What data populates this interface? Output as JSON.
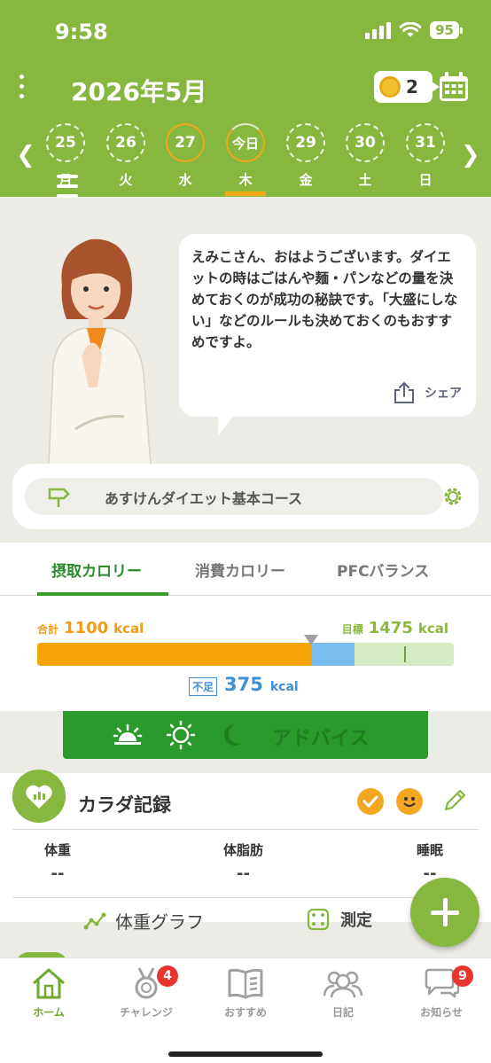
{
  "status": {
    "time": "9:58",
    "battery": "95"
  },
  "header": {
    "title": "2026年5月",
    "badge_count": "2"
  },
  "week": {
    "days": [
      {
        "num": "25",
        "wd": "月"
      },
      {
        "num": "26",
        "wd": "火"
      },
      {
        "num": "27",
        "wd": "水"
      },
      {
        "num": "今日",
        "wd": "木"
      },
      {
        "num": "29",
        "wd": "金"
      },
      {
        "num": "30",
        "wd": "土"
      },
      {
        "num": "31",
        "wd": "日"
      }
    ],
    "prev_icon": "chevron-left-icon",
    "next_icon": "chevron-right-icon"
  },
  "advisor": {
    "message": "えみこさん、おはようございます。ダイエットの時はごはんや麺・パンなどの量を決めておくのが成功の秘訣です。「大盛にしない」などのルールも決めておくのもおすすめですよ。",
    "share_label": "シェア"
  },
  "course": {
    "name": "あすけんダイエット基本コース"
  },
  "calories": {
    "tabs": [
      "摂取カロリー",
      "消費カロリー",
      "PFCバランス"
    ],
    "total_label": "合計",
    "total_value": "1100",
    "goal_label": "目標",
    "goal_value": "1475",
    "unit": "kcal",
    "shortage_label": "不足",
    "shortage_value": "375",
    "intake_fraction": 0.659,
    "colors": {
      "intake": "#f5a50a",
      "shortage": "#78bdf0",
      "remaining": "#d6eac4"
    }
  },
  "advice": {
    "label": "アドバイス"
  },
  "body_record": {
    "title": "カラダ記録",
    "metrics": [
      {
        "label": "体重",
        "value": "--"
      },
      {
        "label": "体脂肪",
        "value": "--"
      },
      {
        "label": "睡眠",
        "value": "--"
      }
    ],
    "graph_label": "体重グラフ",
    "measure_label": "測定"
  },
  "tabbar": {
    "items": [
      {
        "label": "ホーム",
        "icon": "home-icon"
      },
      {
        "label": "チャレンジ",
        "icon": "medal-icon",
        "badge": "4"
      },
      {
        "label": "おすすめ",
        "icon": "book-icon"
      },
      {
        "label": "日記",
        "icon": "people-icon"
      },
      {
        "label": "お知らせ",
        "icon": "chat-icon",
        "badge": "9"
      }
    ]
  },
  "colors": {
    "brand": "#86b73e",
    "accent": "#f5a50a",
    "advice": "#2a9a2a"
  }
}
